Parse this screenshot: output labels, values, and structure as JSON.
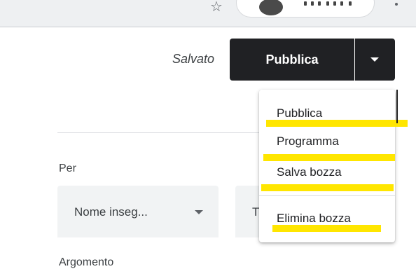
{
  "header": {
    "status_text": "Salvato",
    "publish_label": "Pubblica"
  },
  "form": {
    "for_label": "Per",
    "teacher_value": "Nome inseg...",
    "second_value": "T",
    "topic_label": "Argomento"
  },
  "menu": {
    "items": [
      {
        "label": "Pubblica"
      },
      {
        "label": "Programma"
      },
      {
        "label": "Salva bozza"
      },
      {
        "label": "Elimina bozza"
      }
    ],
    "highlight_color": "#ffe600"
  },
  "colors": {
    "primary_button": "#202124",
    "field_background": "#f1f3f4"
  },
  "icons": {
    "star": "star-icon",
    "profile": "avatar",
    "kebab": "kebab-icon",
    "dropdown": "chevron-down-icon"
  }
}
